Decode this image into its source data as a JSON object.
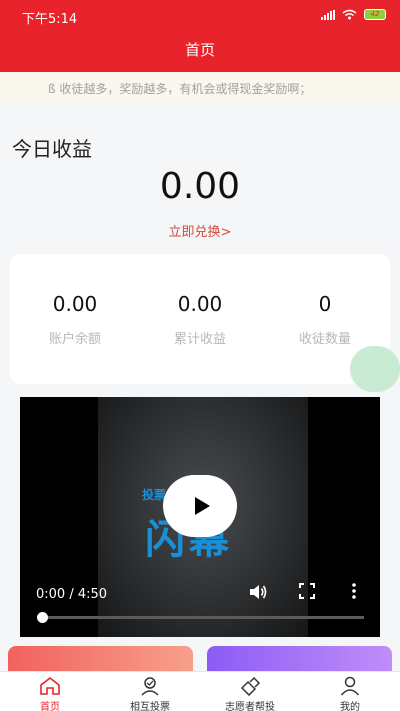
{
  "status_bar": {
    "time": "下午5:14",
    "battery": "42"
  },
  "header": {
    "title": "首页"
  },
  "notice": {
    "text": "ß 收徒越多，奖励越多，有机会或得现金奖励啊；"
  },
  "earnings": {
    "title": "今日收益",
    "value": "0.00",
    "redeem_link": "立即兑换>"
  },
  "stats": [
    {
      "value": "0.00",
      "label": "账户余额"
    },
    {
      "value": "0.00",
      "label": "累计收益"
    },
    {
      "value": "0",
      "label": "收徒数量"
    }
  ],
  "video": {
    "overlay_small": "投票",
    "overlay_large": "闪幕",
    "time": "0:00 / 4:50",
    "progress": 0
  },
  "tabs": [
    {
      "label": "首页",
      "icon": "home-icon",
      "active": true
    },
    {
      "label": "相互投票",
      "icon": "mutual-vote-icon",
      "active": false
    },
    {
      "label": "志愿者帮投",
      "icon": "volunteer-help-icon",
      "active": false
    },
    {
      "label": "我的",
      "icon": "profile-icon",
      "active": false
    }
  ],
  "colors": {
    "brand": "#e8232b",
    "link": "#d04a40",
    "video_text": "#1a8fd6"
  }
}
